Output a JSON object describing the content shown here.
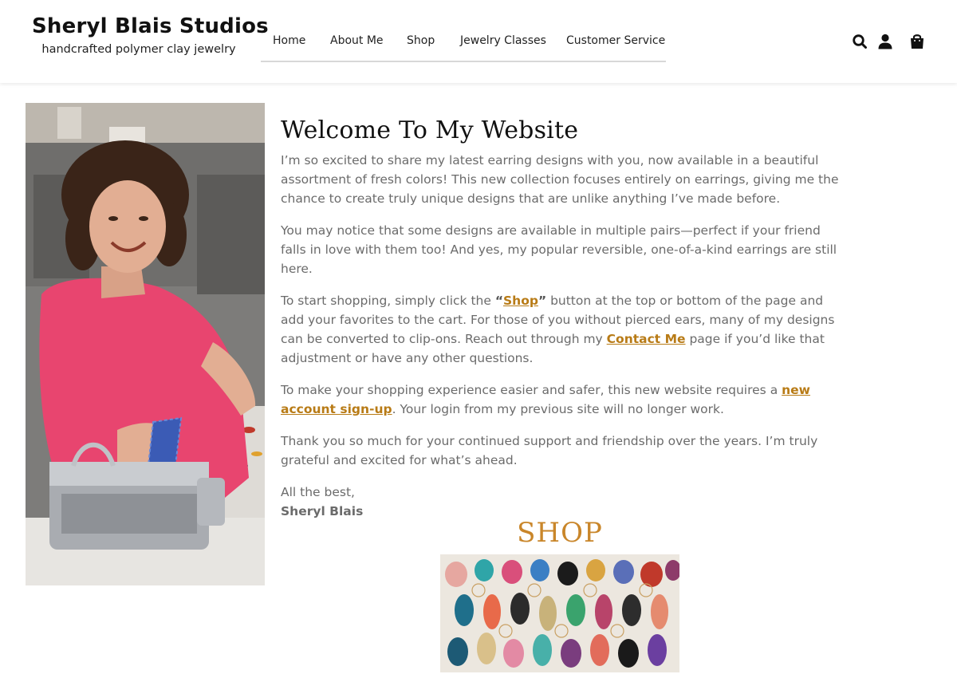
{
  "brand": {
    "title": "Sheryl Blais Studios",
    "tagline": "handcrafted polymer clay jewelry"
  },
  "nav": {
    "items": [
      "Home",
      "About Me",
      "Shop",
      "Jewelry Classes",
      "Customer Service"
    ]
  },
  "header_icons": [
    "search-icon",
    "account-icon",
    "shopping-bag-icon"
  ],
  "main": {
    "heading": "Welcome To My Website",
    "p1": "I’m so excited to share my latest earring designs with you, now available in a beautiful assortment of fresh colors! This new collection focuses entirely on earrings, giving me the chance to create truly unique designs that are unlike anything I’ve made before.",
    "p2": "You may notice that some designs are available in multiple pairs—perfect if your friend falls in love with them too! And yes, my popular reversible, one-of-a-kind earrings are still here.",
    "p3_a": "To start shopping, simply click the ",
    "p3_quote_open": "“",
    "p3_link_shop": "Shop",
    "p3_quote_close": "”",
    "p3_b": " button at the top or bottom of the page and add your favorites to the cart. For those of you without pierced ears, many of my designs can be converted to clip-ons. Reach out through my ",
    "p3_link_contact": "Contact Me",
    "p3_c": " page if you’d like that adjustment or have any other questions.",
    "p4_a": "To make your shopping experience easier and safer, this new website requires a ",
    "p4_link": "new account sign-up",
    "p4_b": ". Your login from my previous site will no longer work.",
    "p5": "Thank you so much for your continued support and friendship over the years. I’m truly grateful and excited for what’s ahead.",
    "closing": "All the best,",
    "signature": "Sheryl Blais"
  },
  "shop_section": {
    "title": "SHOP"
  },
  "colors": {
    "accent": "#b87b16",
    "shop_title": "#c9862a",
    "body_text": "#6b6b6b"
  }
}
